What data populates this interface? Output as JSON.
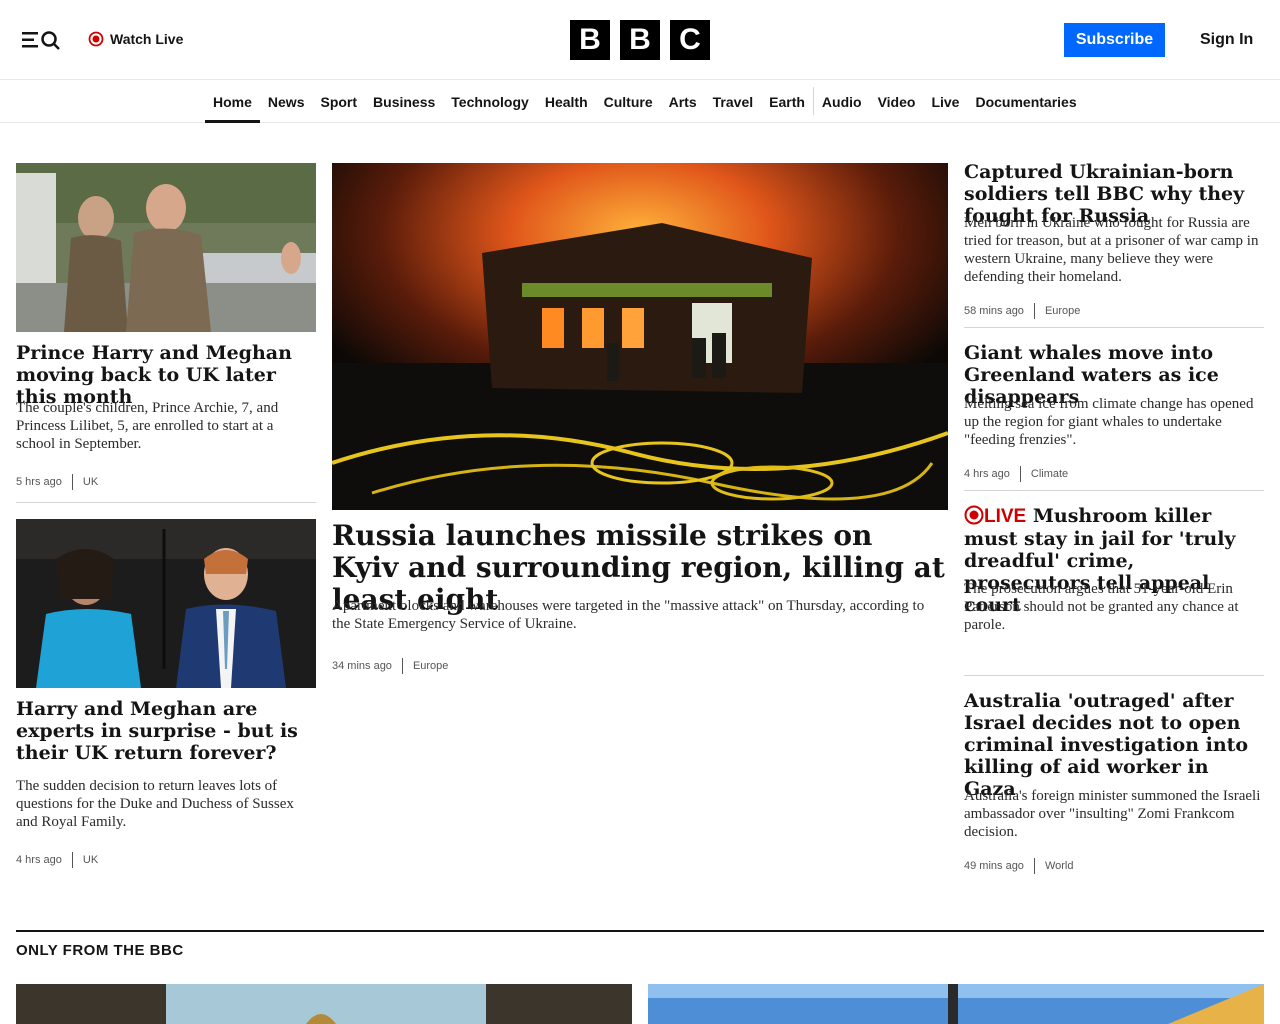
{
  "header": {
    "watch_live": "Watch Live",
    "logo_letters": [
      "B",
      "B",
      "C"
    ],
    "subscribe": "Subscribe",
    "sign_in": "Sign In"
  },
  "nav": {
    "items": [
      "Home",
      "News",
      "Sport",
      "Business",
      "Technology",
      "Health",
      "Culture",
      "Arts",
      "Travel",
      "Earth",
      "Audio",
      "Video",
      "Live",
      "Documentaries"
    ],
    "active": "Home"
  },
  "left": {
    "story1": {
      "headline": "Prince Harry and Meghan moving back to UK later this month",
      "summary": "The couple's children, Prince Archie, 7, and Princess Lilibet, 5, are enrolled to start at a school in September.",
      "time": "5 hrs ago",
      "category": "UK"
    },
    "story2": {
      "headline": "Harry and Meghan are experts in surprise - but is their UK return forever?",
      "summary": "The sudden decision to return leaves lots of questions for the Duke and Duchess of Sussex and Royal Family.",
      "time": "4 hrs ago",
      "category": "UK"
    }
  },
  "main": {
    "headline": "Russia launches missile strikes on Kyiv and surrounding region, killing at least eight",
    "summary": "Apartment blocks and warehouses were targeted in the \"massive attack\" on Thursday, according to the State Emergency Service of Ukraine.",
    "time": "34 mins ago",
    "category": "Europe"
  },
  "right": {
    "story1": {
      "headline": "Captured Ukrainian-born soldiers tell BBC why they fought for Russia",
      "summary": "Men born in Ukraine who fought for Russia are tried for treason, but at a prisoner of war camp in western Ukraine, many believe they were defending their homeland.",
      "time": "58 mins ago",
      "category": "Europe"
    },
    "story2": {
      "headline": "Giant whales move into Greenland waters as ice disappears",
      "summary": "Melting sea ice from climate change has opened up the region for giant whales to undertake \"feeding frenzies\".",
      "time": "4 hrs ago",
      "category": "Climate"
    },
    "story3": {
      "live_label": "LIVE",
      "headline": "Mushroom killer must stay in jail for 'truly dreadful' crime, prosecutors tell appeal court",
      "summary": "The prosecution argues that 51-year-old Erin Patterson should not be granted any chance at parole."
    },
    "story4": {
      "headline": "Australia 'outraged' after Israel decides not to open criminal investigation into killing of aid worker in Gaza",
      "summary": "Australia's foreign minister summoned the Israeli ambassador over \"insulting\" Zomi Frankcom decision.",
      "time": "49 mins ago",
      "category": "World"
    }
  },
  "section": {
    "title": "ONLY FROM THE BBC"
  },
  "colors": {
    "accent_blue": "#0068ff",
    "live_red": "#ce0000",
    "text": "#141414"
  }
}
